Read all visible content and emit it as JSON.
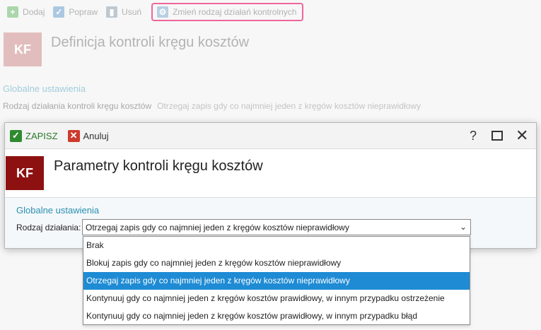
{
  "background": {
    "toolbar": {
      "add_label": "Dodaj",
      "edit_label": "Popraw",
      "delete_label": "Usuń",
      "change_label": "Zmień rodzaj działań kontrolnych"
    },
    "kf_tile": "KF",
    "title": "Definicja kontroli kręgu kosztów",
    "section": "Globalne ustawienia",
    "row_label": "Rodzaj działania kontroli kręgu kosztów",
    "row_value": "Otrzegaj zapis gdy co najmniej jeden z kręgów kosztów nieprawidłowy"
  },
  "dialog": {
    "toolbar": {
      "save_label": "ZAPISZ",
      "cancel_label": "Anuluj",
      "help_label": "?"
    },
    "kf_tile": "KF",
    "title": "Parametry kontroli kręgu kosztów",
    "section": "Globalne ustawienia",
    "field_label": "Rodzaj działania:",
    "field_value": "Otrzegaj zapis gdy co najmniej jeden z kręgów kosztów nieprawidłowy"
  },
  "dropdown": {
    "options": [
      "Brak",
      "Blokuj zapis gdy co najmniej jeden z kręgów kosztów nieprawidłowy",
      "Otrzegaj zapis gdy co najmniej jeden z kręgów kosztów nieprawidłowy",
      "Kontynuuj gdy co najmniej jeden z kręgów kosztów prawidłowy, w innym przypadku ostrzeżenie",
      "Kontynuuj gdy co najmniej jeden z kręgów kosztów prawidłowy, w innym przypadku błąd"
    ],
    "selected_index": 2
  },
  "colors": {
    "accent": "#1e8bd4",
    "kf_tile": "#8e1111",
    "save": "#2f8a2f",
    "cancel": "#cc3b2c",
    "highlight": "#e8337a"
  }
}
